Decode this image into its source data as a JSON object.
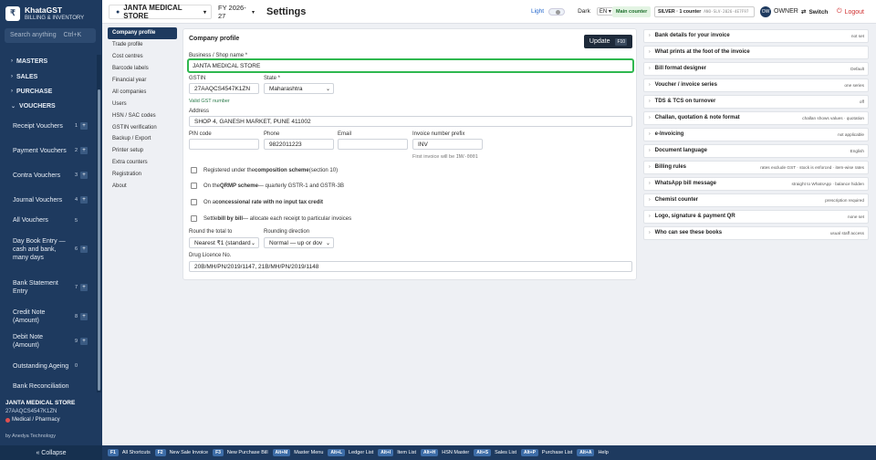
{
  "sidebar": {
    "brand_logo": "₹",
    "brand_name": "KhataGST",
    "brand_sub": "BILLING & INVENTORY",
    "search_placeholder": "Search anything",
    "search_shortcut": "Ctrl+K",
    "sections": [
      {
        "label": "MASTERS"
      },
      {
        "label": "SALES"
      },
      {
        "label": "PURCHASE"
      },
      {
        "label": "VOUCHERS"
      }
    ],
    "vouchers": [
      {
        "label": "Receipt Vouchers",
        "num": "1",
        "plus": "+"
      },
      {
        "label": "Payment Vouchers",
        "num": "2",
        "plus": "+"
      },
      {
        "label": "Contra Vouchers",
        "num": "3",
        "plus": "+"
      },
      {
        "label": "Journal Vouchers",
        "num": "4",
        "plus": "+"
      },
      {
        "label": "All Vouchers",
        "num": "5",
        "plus": ""
      },
      {
        "label": "Day Book Entry — cash and bank, many days",
        "num": "6",
        "plus": "+"
      },
      {
        "label": "Bank Statement Entry",
        "num": "7",
        "plus": "+"
      },
      {
        "label": "Credit Note (Amount)",
        "num": "8",
        "plus": "+"
      },
      {
        "label": "Debit Note (Amount)",
        "num": "9",
        "plus": "+"
      },
      {
        "label": "Outstanding Ageing",
        "num": "0",
        "plus": ""
      },
      {
        "label": "Bank Reconciliation",
        "num": "",
        "plus": ""
      }
    ],
    "store_name": "JANTA MEDICAL STORE",
    "store_gstin": "27AAQCS4547K1ZN",
    "store_type": "Medical / Pharmacy",
    "by_line": "by Anedya Technology",
    "collapse_label": "« Collapse"
  },
  "topbar": {
    "store_label": "JANTA MEDICAL STORE",
    "fy_label": "FY 2026-27",
    "page_title": "Settings",
    "light_label": "Light",
    "dark_label": "Dark",
    "lang": "EN",
    "main_counter": "Main counter",
    "plan_label": "SILVER · 1 counter",
    "plan_code": "ANO-SLV-2026-4E7F97",
    "avatar_initials": "OW",
    "role": "OWNER",
    "switch_label": "Switch",
    "logout_label": "Logout"
  },
  "subnav": [
    "Company profile",
    "Trade profile",
    "Cost centres",
    "Barcode labels",
    "Financial year",
    "All companies",
    "Users",
    "HSN / SAC codes",
    "GSTIN verification",
    "Backup / Export",
    "Printer setup",
    "Extra counters",
    "Registration",
    "About"
  ],
  "form": {
    "heading": "Company profile",
    "update_label": "Update",
    "update_key": "F10",
    "business_label": "Business / Shop name *",
    "business_value": "JANTA MEDICAL STORE",
    "gstin_label": "GSTIN",
    "gstin_value": "27AAQCS4547K1ZN",
    "state_label": "State *",
    "state_value": "Maharashtra",
    "gst_valid": "Valid GST number",
    "address_label": "Address",
    "address_value": "SHOP 4, GANESH MARKET, PUNE 411002",
    "pin_label": "PIN code",
    "pin_value": "",
    "phone_label": "Phone",
    "phone_value": "9822011223",
    "email_label": "Email",
    "email_value": "",
    "prefix_label": "Invoice number prefix",
    "prefix_value": "INV",
    "prefix_hint_pre": "First invoice will be",
    "prefix_hint_code": "INV-0001",
    "checks": [
      {
        "pre": "Registered under the ",
        "bold": "composition scheme",
        "post": " (section 10)"
      },
      {
        "pre": "On the ",
        "bold": "QRMP scheme",
        "post": " — quarterly GSTR-1 and GSTR-3B"
      },
      {
        "pre": "On a ",
        "bold": "concessional rate with no input tax credit",
        "post": ""
      },
      {
        "pre": "Settle ",
        "bold": "bill by bill",
        "post": " — allocate each receipt to particular invoices"
      }
    ],
    "round_label": "Round the total to",
    "round_value": "Nearest ₹1 (standard",
    "rounding_label": "Rounding direction",
    "rounding_value": "Normal — up or dov",
    "drug_label": "Drug Licence No.",
    "drug_value": "20B/MH/PN/2019/1147, 21B/MH/PN/2019/1148"
  },
  "settings_list": [
    {
      "title": "Bank details for your invoice",
      "value": "not set"
    },
    {
      "title": "What prints at the foot of the invoice",
      "value": ""
    },
    {
      "title": "Bill format designer",
      "value": "Default"
    },
    {
      "title": "Voucher / invoice series",
      "value": "one series"
    },
    {
      "title": "TDS & TCS on turnover",
      "value": "off"
    },
    {
      "title": "Challan, quotation & note format",
      "value": "challan shows values · quotation"
    },
    {
      "title": "e-Invoicing",
      "value": "not applicable"
    },
    {
      "title": "Document language",
      "value": "English"
    },
    {
      "title": "Billing rules",
      "value": "rates exclude GST · stock is enforced · item-wise rates"
    },
    {
      "title": "WhatsApp bill message",
      "value": "straight to WhatsApp · balance hidden"
    },
    {
      "title": "Chemist counter",
      "value": "prescription required"
    },
    {
      "title": "Logo, signature & payment QR",
      "value": "none set"
    },
    {
      "title": "Who can see these books",
      "value": "usual staff access"
    }
  ],
  "shortcuts": [
    {
      "key": "F1",
      "label": "All Shortcuts"
    },
    {
      "key": "F2",
      "label": "New Sale Invoice"
    },
    {
      "key": "F3",
      "label": "New Purchase Bill"
    },
    {
      "key": "Alt+M",
      "label": "Master Menu"
    },
    {
      "key": "Alt+L",
      "label": "Ledger List"
    },
    {
      "key": "Alt+I",
      "label": "Item List"
    },
    {
      "key": "Alt+H",
      "label": "HSN Master"
    },
    {
      "key": "Alt+S",
      "label": "Sales List"
    },
    {
      "key": "Alt+P",
      "label": "Purchase List"
    },
    {
      "key": "Alt+A",
      "label": "Help"
    }
  ]
}
